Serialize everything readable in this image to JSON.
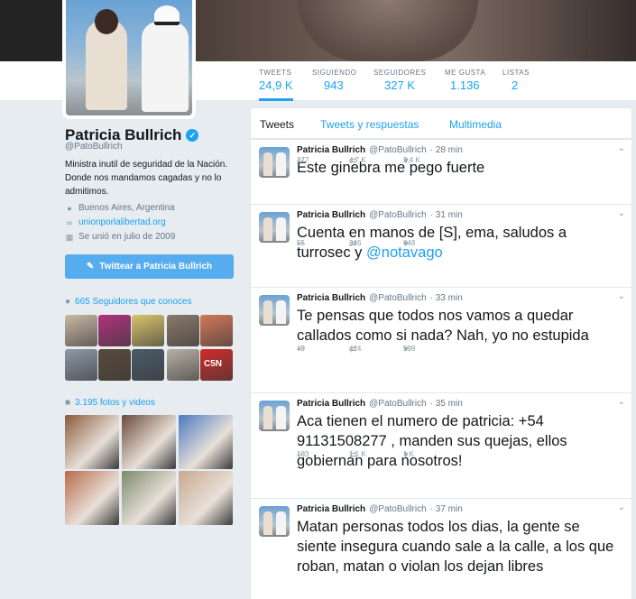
{
  "profile": {
    "name": "Patricia Bullrich",
    "handle": "@PatoBullrich",
    "bio": "Ministra inutil de seguridad de la Nación. Donde nos mandamos cagadas y no lo admitimos.",
    "location": "Buenos Aires, Argentina",
    "website": "unionporlalibertad.org",
    "joined": "Se unió en julio de 2009",
    "tweet_to_button": "Twittear a Patricia Bullrich",
    "followers_you_know": "665 Seguidores que conoces",
    "photos_videos": "3.195 fotos y videos"
  },
  "stats": [
    {
      "label": "TWEETS",
      "value": "24,9 K"
    },
    {
      "label": "SIGUIENDO",
      "value": "943"
    },
    {
      "label": "SEGUIDORES",
      "value": "327 K"
    },
    {
      "label": "ME GUSTA",
      "value": "1.136"
    },
    {
      "label": "LISTAS",
      "value": "2"
    }
  ],
  "tabs": [
    {
      "label": "Tweets"
    },
    {
      "label": "Tweets y respuestas"
    },
    {
      "label": "Multimedia"
    }
  ],
  "known_followers": [
    {
      "icon": "follower-avatar",
      "color": "#c9b8a6"
    },
    {
      "icon": "follower-avatar",
      "color": "#b0327d"
    },
    {
      "icon": "follower-avatar",
      "color": "#d8c46a"
    },
    {
      "icon": "follower-avatar",
      "color": "#8a7a6a"
    },
    {
      "icon": "follower-avatar",
      "color": "#d4785a"
    },
    {
      "icon": "follower-avatar",
      "color": "#8c9aa8"
    },
    {
      "icon": "follower-avatar",
      "color": "#5a4a3a"
    },
    {
      "icon": "follower-avatar",
      "color": "#4a5a6a"
    },
    {
      "icon": "follower-avatar",
      "color": "#b8b0a6"
    },
    {
      "icon": "follower-avatar",
      "color": "#d12a2a",
      "label": "C5N"
    }
  ],
  "photos": [
    {
      "color": "#8a5a3a"
    },
    {
      "color": "#6a4a3a"
    },
    {
      "color": "#4a7ac0"
    },
    {
      "color": "#b86a4a"
    },
    {
      "color": "#7a8a6a"
    },
    {
      "color": "#c8a890"
    }
  ],
  "tweets": [
    {
      "name": "Patricia Bullrich",
      "handle": "@PatoBullrich",
      "time": "· 28 min",
      "text": "Este ginebra me pego fuerte",
      "mention": "",
      "replies": "277",
      "retweets": "4,7 K",
      "likes": "3,4 K"
    },
    {
      "name": "Patricia Bullrich",
      "handle": "@PatoBullrich",
      "time": "· 31 min",
      "text": "Cuenta en manos de [S], ema, saludos a turrosec y ",
      "mention": "@notavago",
      "replies": "55",
      "retweets": "346",
      "likes": "648"
    },
    {
      "name": "Patricia Bullrich",
      "handle": "@PatoBullrich",
      "time": "· 33 min",
      "text": "Te pensas que todos nos vamos a quedar callados como si nada? Nah, yo no estupida",
      "mention": "",
      "replies": "49",
      "retweets": "424",
      "likes": "599"
    },
    {
      "name": "Patricia Bullrich",
      "handle": "@PatoBullrich",
      "time": "· 35 min",
      "text": "Aca tienen el numero de patricia: +54 91131508277 , manden sus quejas, ellos gobiernan para nosotros!",
      "mention": "",
      "replies": "103",
      "retweets": "1,1 K",
      "likes": "1 K"
    },
    {
      "name": "Patricia Bullrich",
      "handle": "@PatoBullrich",
      "time": "· 37 min",
      "text": "Matan personas todos los dias, la gente se siente insegura cuando sale a la calle, a los que roban, matan o violan los dejan libres",
      "mention": "",
      "replies": "",
      "retweets": "",
      "likes": ""
    }
  ]
}
